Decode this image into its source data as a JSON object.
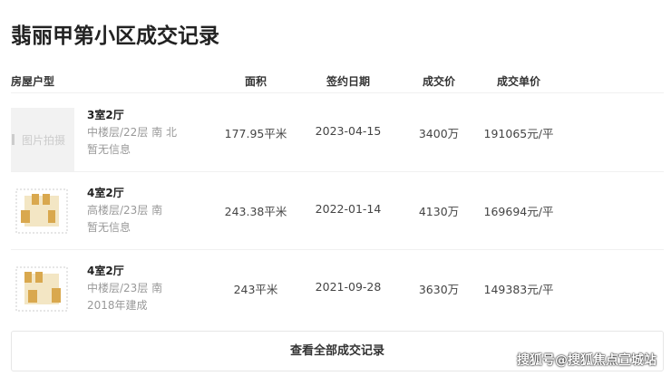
{
  "title": "翡丽甲第小区成交记录",
  "headers": {
    "type": "房屋户型",
    "area": "面积",
    "date": "签约日期",
    "price": "成交价",
    "unit": "成交单价"
  },
  "rows": [
    {
      "image": "图片拍摄",
      "layout": "3室2厅",
      "floor": "中楼层/22层 南 北",
      "extra": "暂无信息",
      "area": "177.95平米",
      "date": "2023-04-15",
      "price": "3400万",
      "unit": "191065元/平"
    },
    {
      "layout": "4室2厅",
      "floor": "高楼层/23层 南",
      "extra": "暂无信息",
      "area": "243.38平米",
      "date": "2022-01-14",
      "price": "4130万",
      "unit": "169694元/平"
    },
    {
      "layout": "4室2厅",
      "floor": "中楼层/23层 南",
      "extra": "2018年建成",
      "area": "243平米",
      "date": "2021-09-28",
      "price": "3630万",
      "unit": "149383元/平"
    }
  ],
  "button": "查看全部成交记录",
  "watermark": "搜狐号@搜狐焦点宣城站"
}
